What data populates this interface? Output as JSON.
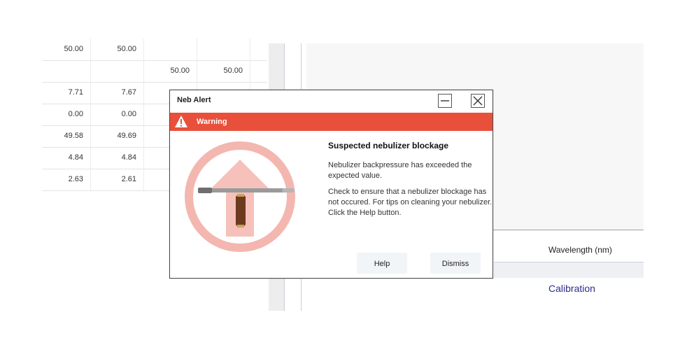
{
  "background_table": {
    "rows": [
      [
        "50.00",
        "50.00",
        "",
        ""
      ],
      [
        "",
        "",
        "50.00",
        "50.00"
      ],
      [
        "7.71",
        "7.67",
        "",
        ""
      ],
      [
        "0.00",
        "0.00",
        "",
        ""
      ],
      [
        "49.58",
        "49.69",
        "",
        ""
      ],
      [
        "4.84",
        "4.84",
        "",
        ""
      ],
      [
        "2.63",
        "2.61",
        "",
        ""
      ]
    ]
  },
  "right_panel": {
    "wavelength_label": "Wavelength (nm)",
    "dots": "..........",
    "calibration_label": "Calibration"
  },
  "dialog": {
    "title": "Neb Alert",
    "warning_label": "Warning",
    "heading": "Suspected nebulizer blockage",
    "paragraph1": "Nebulizer backpressure has exceeded the expected value.",
    "paragraph2": "Check to ensure that a nebulizer blockage has not occured. For tips on cleaning your nebulizer. Click the Help button.",
    "help_button": "Help",
    "dismiss_button": "Dismiss",
    "icons": {
      "minimize": "minimize-icon",
      "close": "close-icon",
      "warning": "warning-triangle-icon",
      "illustration": "nebulizer-pressure-up-icon"
    },
    "colors": {
      "warning_bar": "#e9503b",
      "circle": "#f3b7b0",
      "arrow": "#f6c1ba",
      "nebulizer_body": "#6b3a1f"
    }
  }
}
